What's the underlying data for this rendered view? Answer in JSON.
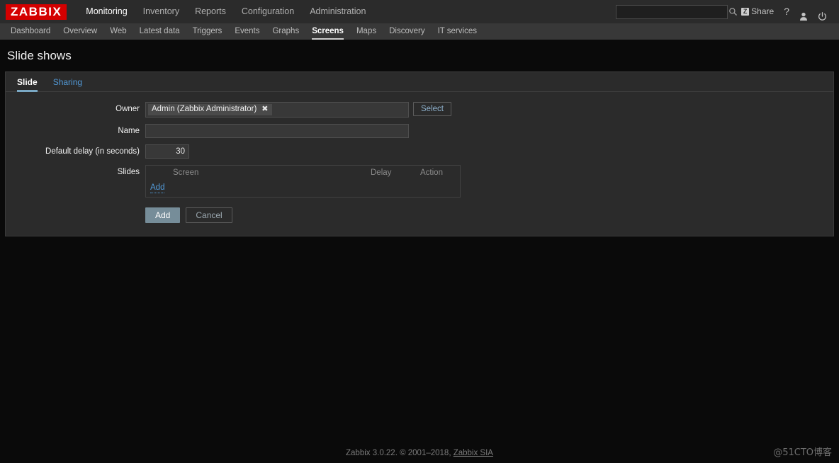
{
  "header": {
    "logo": "ZABBIX",
    "main_nav": [
      {
        "label": "Monitoring",
        "selected": true
      },
      {
        "label": "Inventory",
        "selected": false
      },
      {
        "label": "Reports",
        "selected": false
      },
      {
        "label": "Configuration",
        "selected": false
      },
      {
        "label": "Administration",
        "selected": false
      }
    ],
    "search": {
      "value": "",
      "placeholder": "",
      "icon": "search-icon"
    },
    "share": {
      "label": "Share",
      "badge": "Z",
      "icon": "share-icon"
    },
    "help": {
      "label": "?",
      "icon": "help-icon"
    },
    "user": {
      "icon": "user-icon"
    },
    "logout": {
      "icon": "power-icon"
    }
  },
  "sub_nav": [
    {
      "label": "Dashboard",
      "selected": false
    },
    {
      "label": "Overview",
      "selected": false
    },
    {
      "label": "Web",
      "selected": false
    },
    {
      "label": "Latest data",
      "selected": false
    },
    {
      "label": "Triggers",
      "selected": false
    },
    {
      "label": "Events",
      "selected": false
    },
    {
      "label": "Graphs",
      "selected": false
    },
    {
      "label": "Screens",
      "selected": true
    },
    {
      "label": "Maps",
      "selected": false
    },
    {
      "label": "Discovery",
      "selected": false
    },
    {
      "label": "IT services",
      "selected": false
    }
  ],
  "page": {
    "title": "Slide shows"
  },
  "tabs": [
    {
      "label": "Slide",
      "active": true
    },
    {
      "label": "Sharing",
      "active": false
    }
  ],
  "form": {
    "owner": {
      "label": "Owner",
      "chip": "Admin (Zabbix Administrator)",
      "chip_remove": "✖",
      "select_button": "Select"
    },
    "name": {
      "label": "Name",
      "value": "",
      "placeholder": ""
    },
    "default_delay": {
      "label": "Default delay (in seconds)",
      "value": "30"
    },
    "slides": {
      "label": "Slides",
      "columns": [
        "Screen",
        "Delay",
        "Action"
      ],
      "rows": [],
      "add_link": "Add"
    },
    "buttons": {
      "submit": "Add",
      "cancel": "Cancel"
    }
  },
  "footer": {
    "text_before": "Zabbix 3.0.22. © 2001–2018, ",
    "link": "Zabbix SIA",
    "watermark": "@51CTO博客"
  },
  "colors": {
    "brand_red": "#d40000",
    "link_blue": "#529ad8",
    "panel_bg": "#2b2b2b",
    "page_bg": "#0a0a0a",
    "subnav_bg": "#383838",
    "primary_button": "#768d99"
  }
}
